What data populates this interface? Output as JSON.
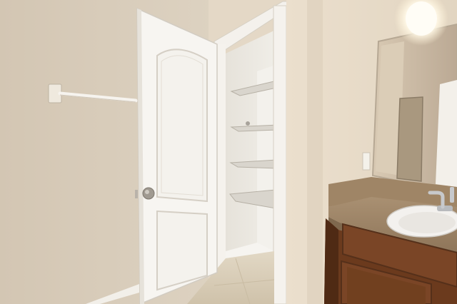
{
  "scene": {
    "subject": "bathroom",
    "colors": {
      "wall_left": "#d9cdbb",
      "wall_right": "#e6d9c6",
      "door": "#f7f5f1",
      "door_shadow": "#dcd8d0",
      "closet_interior": "#e9e6e0",
      "floor": "#d8ccb6",
      "cabinet": "#6b3a1d",
      "countertop": "#a48a6c",
      "sink": "#f3f1ee",
      "faucet": "#c7c9cc",
      "mirror": "#c9b9a3",
      "knob": "#9a948c",
      "light": "#fffdf6"
    }
  }
}
